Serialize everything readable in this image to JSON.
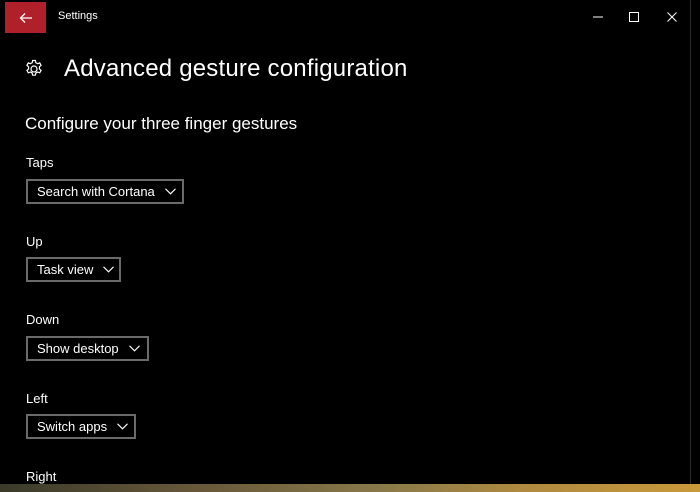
{
  "window": {
    "title": "Settings",
    "accent_color": "#b0202a"
  },
  "icons": {
    "back": "arrow-left-icon",
    "minimize": "minimize-icon",
    "maximize": "maximize-icon",
    "close": "close-icon",
    "page": "gear-icon"
  },
  "page": {
    "title": "Advanced gesture configuration",
    "section_title": "Configure your three finger gestures"
  },
  "gestures": [
    {
      "label": "Taps",
      "selected": "Search with Cortana"
    },
    {
      "label": "Up",
      "selected": "Task view"
    },
    {
      "label": "Down",
      "selected": "Show desktop"
    },
    {
      "label": "Left",
      "selected": "Switch apps"
    },
    {
      "label": "Right",
      "selected": ""
    }
  ]
}
